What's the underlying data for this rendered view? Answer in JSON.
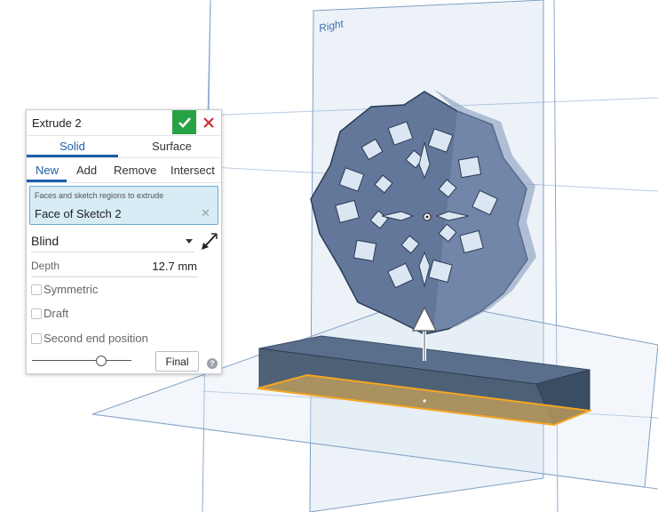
{
  "viewport": {
    "plane_label": "Right"
  },
  "feature_dialog": {
    "title": "Extrude 2",
    "ok_icon": "checkmark-icon",
    "cancel_icon": "close-icon",
    "body_type_tabs": [
      {
        "label": "Solid",
        "active": true
      },
      {
        "label": "Surface",
        "active": false
      }
    ],
    "operation_tabs": [
      {
        "label": "New",
        "active": true
      },
      {
        "label": "Add",
        "active": false
      },
      {
        "label": "Remove",
        "active": false
      },
      {
        "label": "Intersect",
        "active": false
      }
    ],
    "selection": {
      "label": "Faces and sketch regions to extrude",
      "value": "Face of Sketch 2",
      "clear_icon": "x-icon"
    },
    "end_type": {
      "selected": "Blind",
      "flip_icon": "direction-arrow-icon"
    },
    "depth": {
      "label": "Depth",
      "value": "12.7 mm"
    },
    "options": [
      {
        "label": "Symmetric",
        "checked": false
      },
      {
        "label": "Draft",
        "checked": false
      },
      {
        "label": "Second end position",
        "checked": false
      }
    ],
    "final_button": "Final",
    "help_icon": "?",
    "accent_color": "#1a5faa",
    "ok_color": "#27a244",
    "cancel_color": "#c8323c"
  }
}
